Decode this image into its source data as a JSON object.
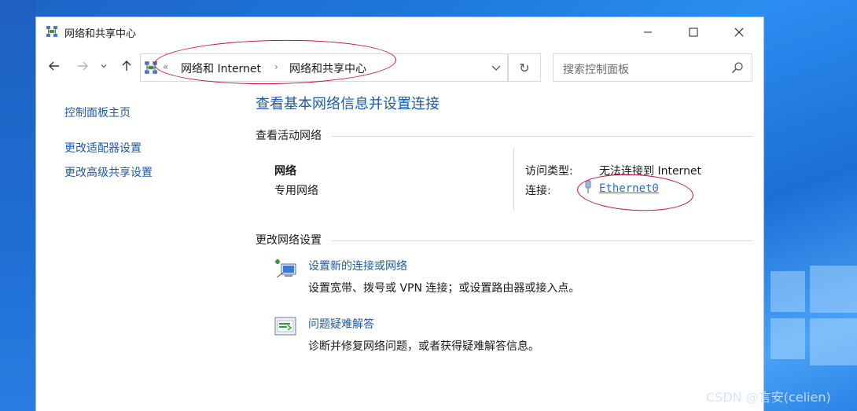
{
  "window": {
    "title": "网络和共享中心",
    "icon": "network-center-icon"
  },
  "navigation": {
    "back": "back-arrow-icon",
    "forward": "forward-arrow-icon",
    "recent": "chevron-down-icon",
    "up": "up-arrow-icon",
    "address": {
      "overflow": "«",
      "crumbs": [
        "网络和 Internet",
        "网络和共享中心"
      ],
      "separator": "›"
    },
    "search": {
      "placeholder": "搜索控制面板"
    }
  },
  "sidebar": {
    "items": [
      {
        "label": "控制面板主页"
      },
      {
        "label": "更改适配器设置"
      },
      {
        "label": "更改高级共享设置"
      }
    ]
  },
  "main": {
    "title": "查看基本网络信息并设置连接",
    "active_networks": {
      "heading": "查看活动网络",
      "network_name": "网络",
      "network_type": "专用网络",
      "access_type_label": "访问类型:",
      "access_type_value": "无法连接到 Internet",
      "connections_label": "连接:",
      "connection_name": "Ethernet0"
    },
    "change_settings": {
      "heading": "更改网络设置",
      "tasks": [
        {
          "title": "设置新的连接或网络",
          "desc": "设置宽带、拨号或 VPN 连接；或设置路由器或接入点。",
          "icon": "new-connection-icon"
        },
        {
          "title": "问题疑难解答",
          "desc": "诊断并修复网络问题，或者获得疑难解答信息。",
          "icon": "troubleshoot-icon"
        }
      ]
    }
  },
  "watermark": "CSDN @言安(celien)",
  "colors": {
    "link": "#1d5aa6",
    "annotation": "#c8102e"
  }
}
